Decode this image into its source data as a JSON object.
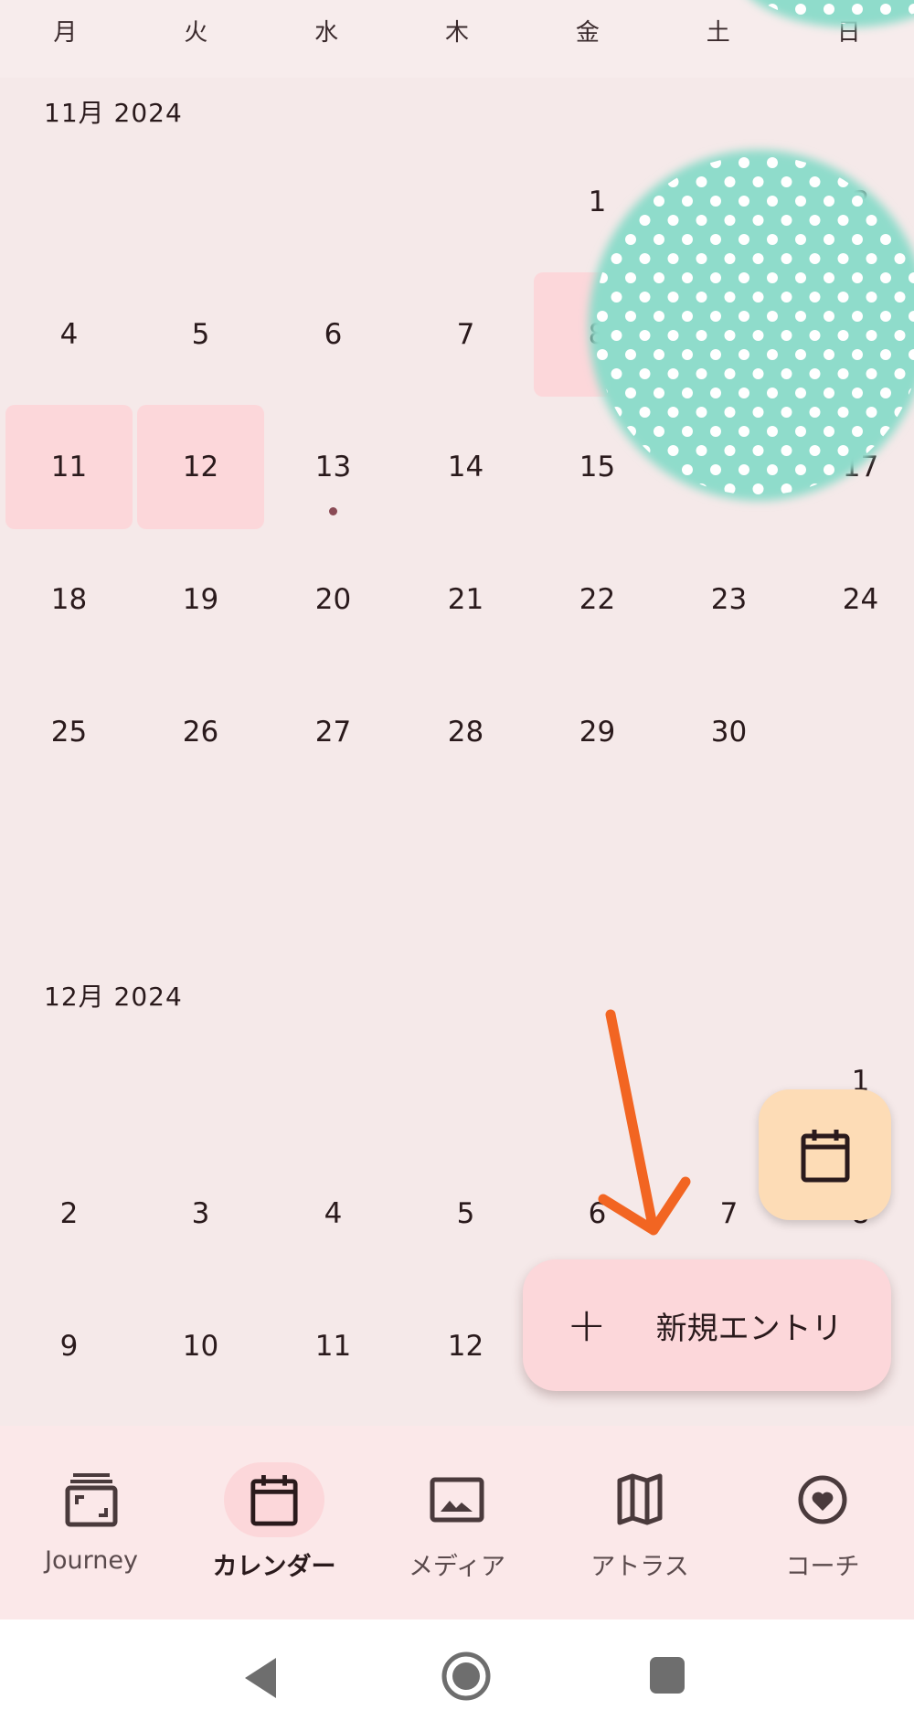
{
  "weekdays": [
    "月",
    "火",
    "水",
    "木",
    "金",
    "土",
    "日"
  ],
  "months": [
    {
      "label": "11月 2024",
      "days": [
        [
          "",
          "",
          "",
          "",
          "1",
          "",
          "3"
        ],
        [
          "4",
          "5",
          "6",
          "7",
          "8",
          "",
          ""
        ],
        [
          "11",
          "12",
          "13",
          "14",
          "15",
          "",
          "17"
        ],
        [
          "18",
          "19",
          "20",
          "21",
          "22",
          "23",
          "24"
        ],
        [
          "25",
          "26",
          "27",
          "28",
          "29",
          "30",
          ""
        ]
      ],
      "highlighted": [
        "8",
        "11",
        "12"
      ],
      "entry_dots": [
        "13"
      ]
    },
    {
      "label": "12月 2024",
      "days": [
        [
          "",
          "",
          "",
          "",
          "",
          "",
          "1"
        ],
        [
          "2",
          "3",
          "4",
          "5",
          "6",
          "7",
          "8"
        ],
        [
          "9",
          "10",
          "11",
          "12",
          "",
          "",
          ""
        ]
      ]
    }
  ],
  "fab": {
    "today_icon": "calendar-icon",
    "new_entry_label": "新規エントリ",
    "new_entry_icon": "plus-icon"
  },
  "nav": [
    {
      "label": "Journey",
      "icon": "journey-icon"
    },
    {
      "label": "カレンダー",
      "icon": "calendar-icon",
      "active": true
    },
    {
      "label": "メディア",
      "icon": "image-icon"
    },
    {
      "label": "アトラス",
      "icon": "map-icon"
    },
    {
      "label": "コーチ",
      "icon": "heart-circle-icon"
    }
  ],
  "colors": {
    "background": "#f5e9e9",
    "highlight": "#fcd7da",
    "fab_today": "#fddcb6",
    "annotation_arrow": "#f26522",
    "sticker": "#8fdccb"
  }
}
